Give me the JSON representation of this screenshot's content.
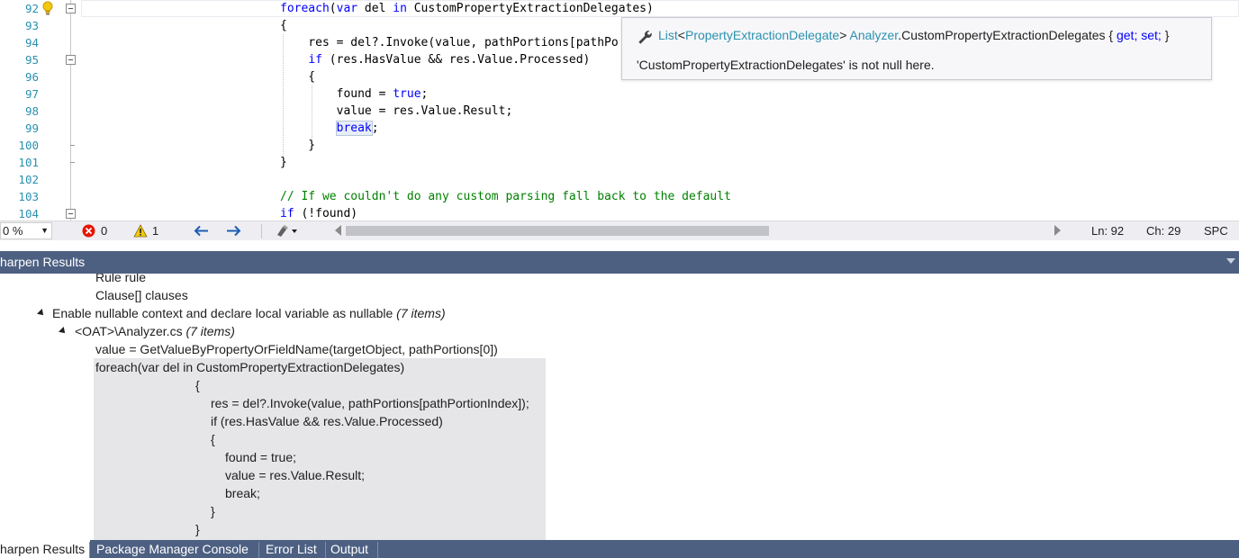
{
  "editor": {
    "lines": [
      {
        "num": "92",
        "code": "foreach(var del in CustomPropertyExtractionDelegates)"
      },
      {
        "num": "93",
        "code": "{"
      },
      {
        "num": "94",
        "code": "    res = del?.Invoke(value, pathPortions[pathPo"
      },
      {
        "num": "95",
        "code": "    if (res.HasValue && res.Value.Processed)"
      },
      {
        "num": "96",
        "code": "    {"
      },
      {
        "num": "97",
        "code": "        found = true;"
      },
      {
        "num": "98",
        "code": "        value = res.Value.Result;"
      },
      {
        "num": "99",
        "code": "        break;"
      },
      {
        "num": "100",
        "code": "    }"
      },
      {
        "num": "101",
        "code": "}"
      },
      {
        "num": "102",
        "code": ""
      },
      {
        "num": "103",
        "code": "// If we couldn't do any custom parsing fall back to the default"
      },
      {
        "num": "104",
        "code": "if (!found)"
      }
    ]
  },
  "tooltip": {
    "icon": "wrench-icon",
    "sig_type": "List",
    "sig_lt": "<",
    "sig_generic": "PropertyExtractionDelegate",
    "sig_gt": ">",
    "sig_class": "Analyzer",
    "sig_member": ".CustomPropertyExtractionDelegates { ",
    "sig_get": "get;",
    "sig_set": "set;",
    "sig_end": " }",
    "description": "'CustomPropertyExtractionDelegates' is not null here."
  },
  "editor_status": {
    "zoom": "0 %",
    "errors": "0",
    "warnings": "1",
    "line": "Ln: 92",
    "char": "Ch: 29",
    "mode": "SPC"
  },
  "tool_window": {
    "title": "harpen Results",
    "results": {
      "partial_line_1": "Rule rule",
      "partial_line_2": "Clause[] clauses",
      "group_label": "Enable nullable context and declare local variable as nullable ",
      "group_count": "(7 items)",
      "file_label": "<OAT>\\Analyzer.cs ",
      "file_count": "(7 items)",
      "item_1": "value = GetValueByPropertyOrFieldName(targetObject, pathPortions[0])",
      "snippet_lines": [
        "foreach(var del in CustomPropertyExtractionDelegates)",
        "{",
        "res = del?.Invoke(value, pathPortions[pathPortionIndex]);",
        "if (res.HasValue && res.Value.Processed)",
        "{",
        "found = true;",
        "value = res.Value.Result;",
        "break;",
        "}",
        "}"
      ]
    }
  },
  "bottom_tabs": [
    {
      "label": "harpen Results",
      "active": true
    },
    {
      "label": "Package Manager Console",
      "active": false
    },
    {
      "label": "Error List",
      "active": false
    },
    {
      "label": "Output",
      "active": false
    }
  ],
  "colors": {
    "keyword": "#0000ff",
    "comment": "#008000",
    "type": "#2b91af",
    "tool_header": "#4d6082"
  }
}
